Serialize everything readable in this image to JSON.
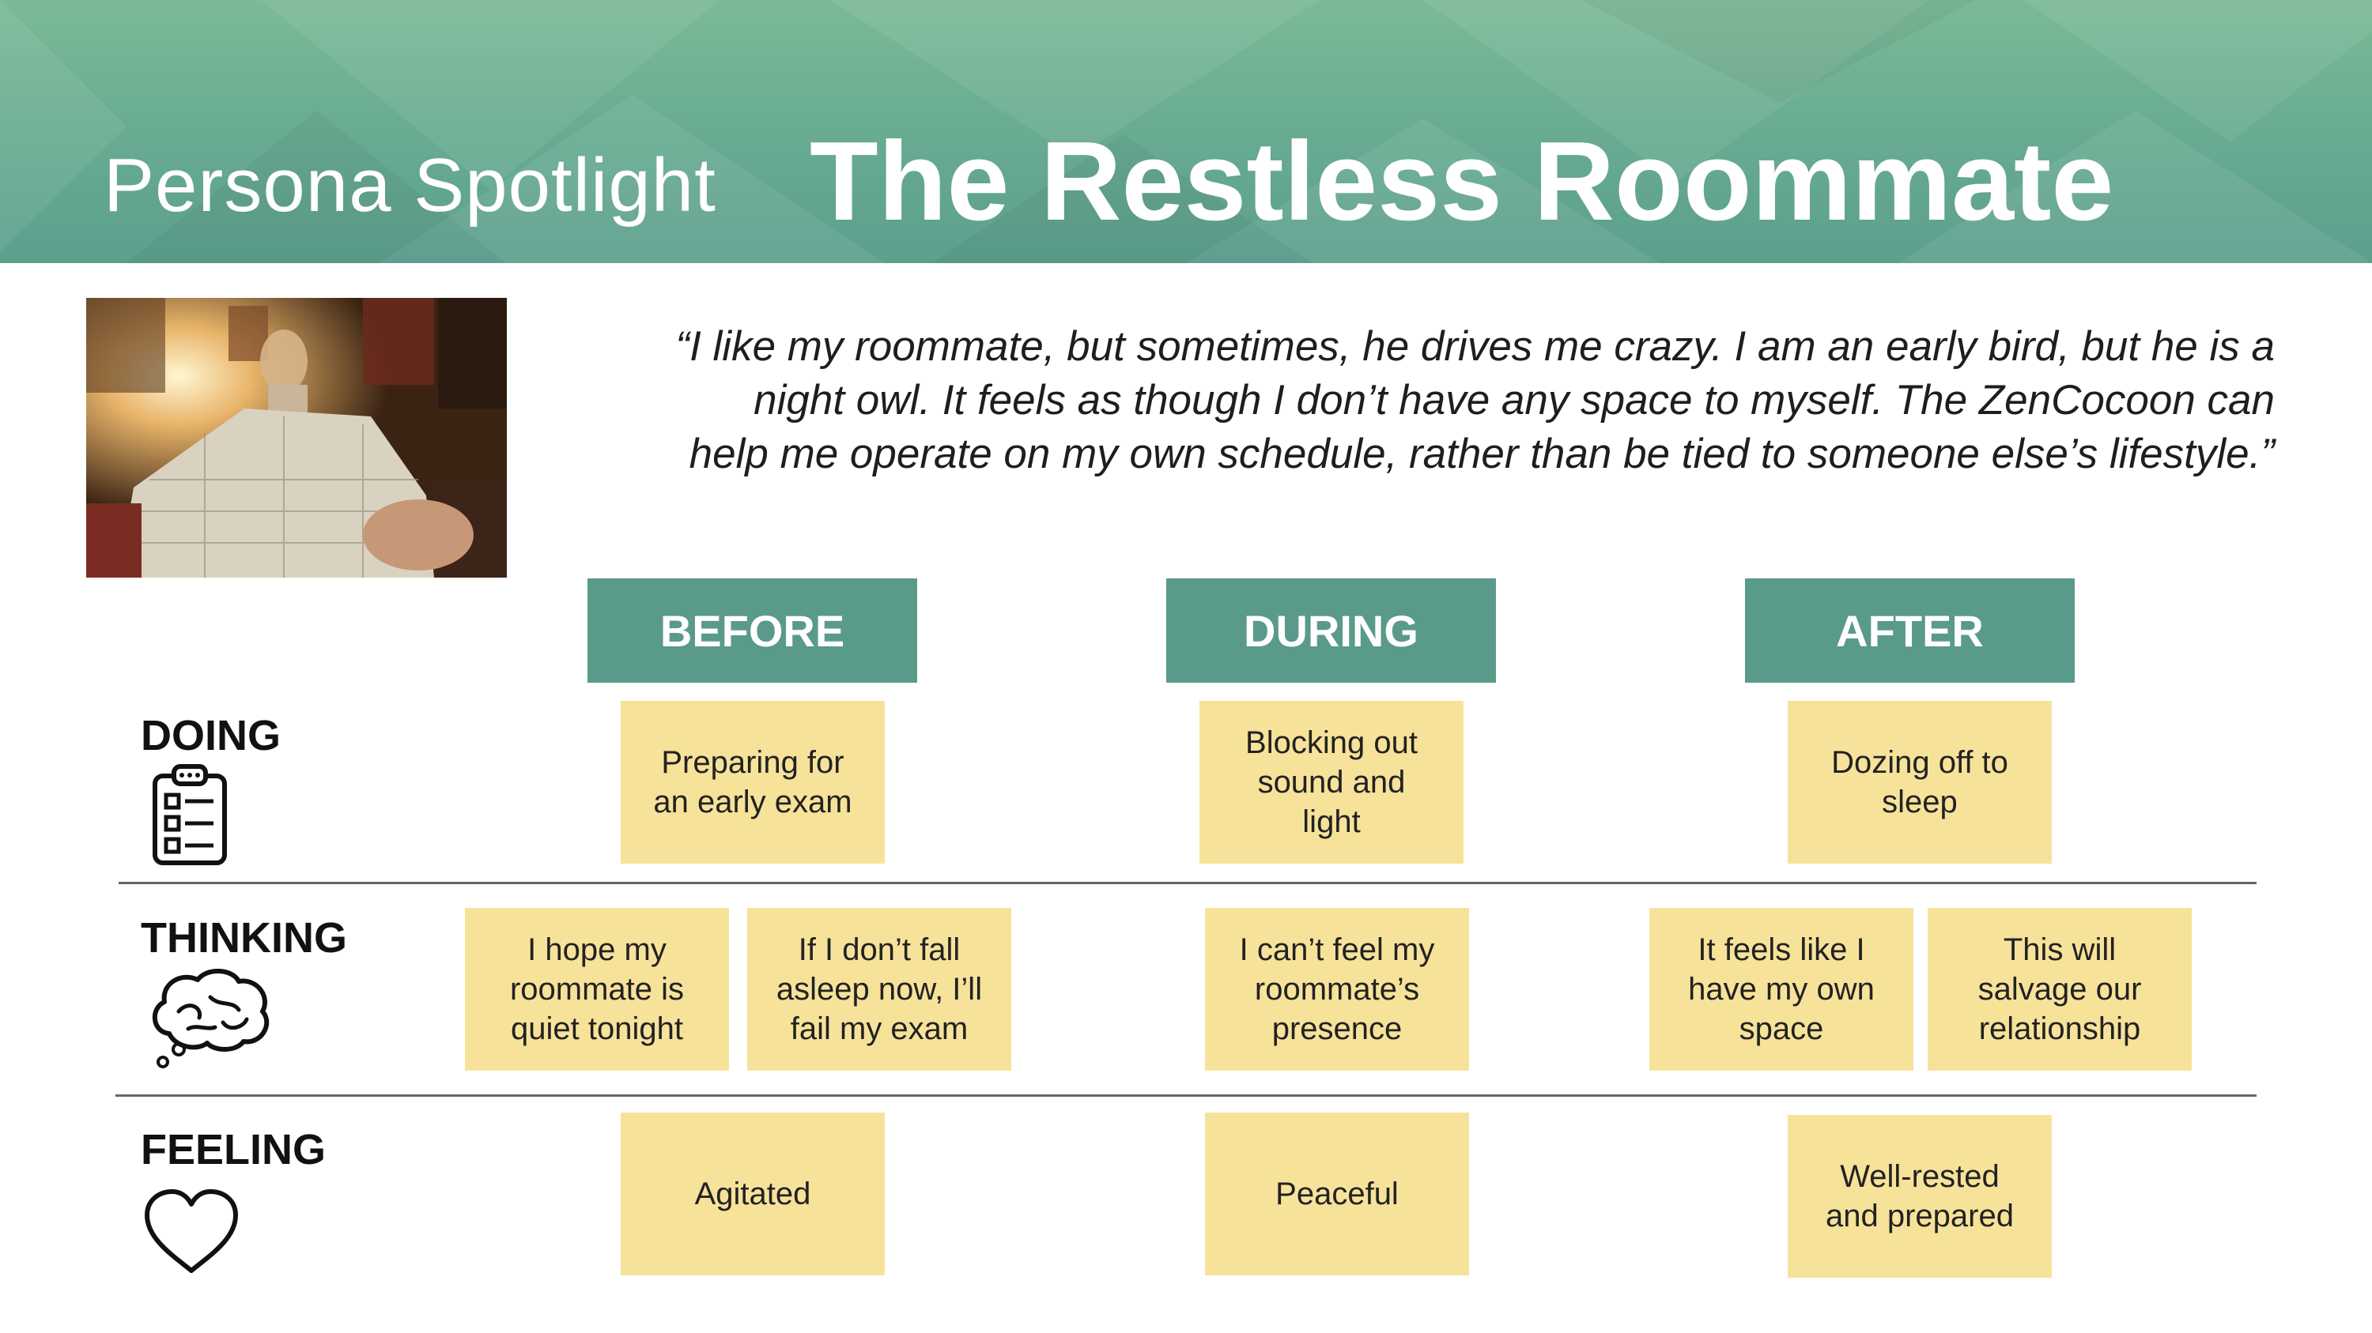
{
  "header": {
    "label": "Persona Spotlight",
    "title": "The Restless Roommate"
  },
  "photo": {
    "alt": "Student trying to sleep under a blanket while roommate plays guitar"
  },
  "quote": {
    "lines": [
      "“I like my roommate, but sometimes, he drives me crazy. I am an early bird, but he is a",
      "night owl. It feels as though I don’t have any space to myself. The ZenCocoon can",
      "help me operate on my own schedule, rather than be tied to someone else’s lifestyle.”"
    ]
  },
  "phases": [
    "BEFORE",
    "DURING",
    "AFTER"
  ],
  "rows": {
    "doing": {
      "label": "DOING",
      "icon": "clipboard-checklist-icon"
    },
    "thinking": {
      "label": "THINKING",
      "icon": "brain-thought-bubble-icon"
    },
    "feeling": {
      "label": "FEELING",
      "icon": "heart-icon"
    }
  },
  "notes": {
    "doing_before": "Preparing for\nan early exam",
    "doing_during": "Blocking out\nsound and\nlight",
    "doing_after": "Dozing off to\nsleep",
    "thinking_before_1": "I hope my\nroommate is\nquiet tonight",
    "thinking_before_2": "If I don’t fall\nasleep now, I’ll\nfail my exam",
    "thinking_during": "I can’t feel my\nroommate’s\npresence",
    "thinking_after_1": "It feels like I\nhave my own\nspace",
    "thinking_after_2": "This will\nsalvage our\nrelationship",
    "feeling_before": "Agitated",
    "feeling_during": "Peaceful",
    "feeling_after": "Well-rested\nand prepared"
  },
  "colors": {
    "header": "#6aad92",
    "phase": "#5a9a8a",
    "note": "#f7e29a",
    "divider": "#666666"
  }
}
